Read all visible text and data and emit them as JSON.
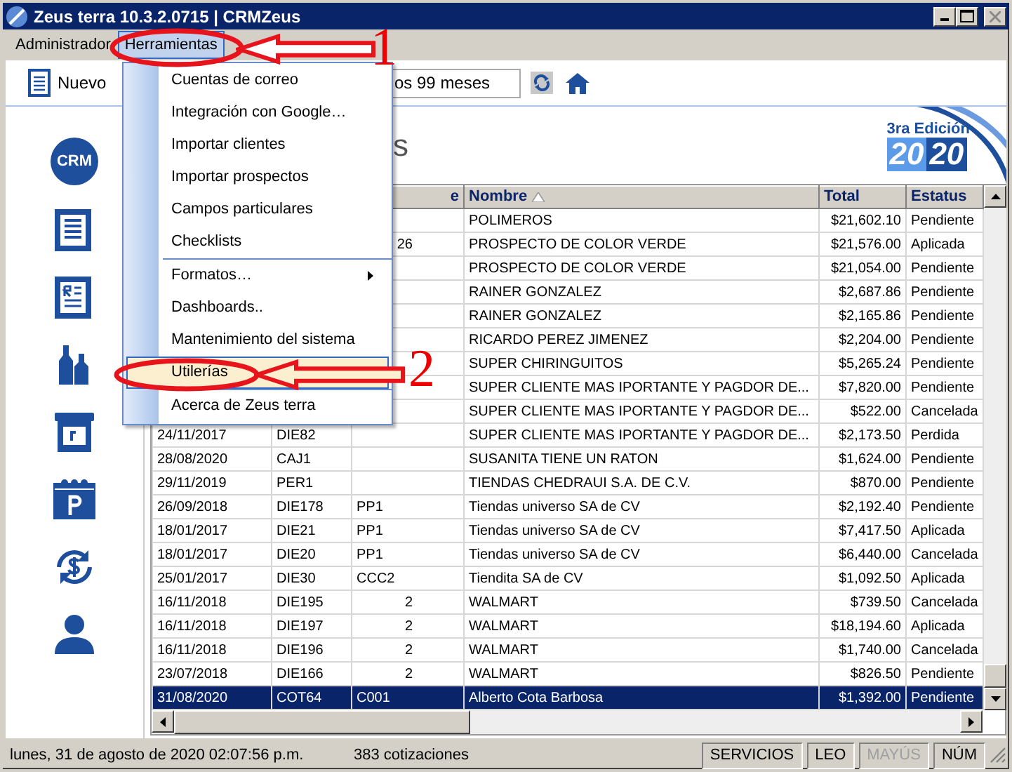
{
  "window": {
    "title": "Zeus terra 10.3.2.0715 | CRMZeus"
  },
  "menu_bar": [
    {
      "label": "Administrador",
      "selected": false
    },
    {
      "label": "Herramientas",
      "selected": true
    }
  ],
  "toolbar": {
    "new_button": "Nuevo",
    "period_field": "os 99 meses"
  },
  "dropdown_menu": [
    {
      "kind": "item",
      "label": "Cuentas de correo",
      "selected": false
    },
    {
      "kind": "item",
      "label": "Integración con Google…",
      "selected": false
    },
    {
      "kind": "item",
      "label": "Importar clientes",
      "selected": false
    },
    {
      "kind": "item",
      "label": "Importar prospectos",
      "selected": false
    },
    {
      "kind": "item",
      "label": "Campos particulares",
      "selected": false
    },
    {
      "kind": "item",
      "label": "Checklists",
      "selected": false
    },
    {
      "kind": "separator"
    },
    {
      "kind": "submenu",
      "label": "Formatos…",
      "selected": false
    },
    {
      "kind": "item",
      "label": "Dashboards..",
      "selected": false
    },
    {
      "kind": "item",
      "label": "Mantenimiento del sistema",
      "selected": false
    },
    {
      "kind": "item",
      "label": "Utilerías",
      "selected": true
    },
    {
      "kind": "separator"
    },
    {
      "kind": "item",
      "label": "Acerca de Zeus terra",
      "selected": false
    }
  ],
  "annotations": [
    {
      "number": "1"
    },
    {
      "number": "2"
    }
  ],
  "sidebar": {
    "logo": "CRM"
  },
  "page_heading": "s",
  "edition_badge": {
    "label": "3ra Edición",
    "year_parts": [
      "20",
      "20"
    ]
  },
  "table": {
    "columns": [
      {
        "label": "e",
        "sorted": false
      },
      {
        "label": "Nombre",
        "sorted": true
      },
      {
        "label": "Total",
        "sorted": false
      },
      {
        "label": "Estatus",
        "sorted": false
      }
    ],
    "rows": [
      {
        "name": "POLIMEROS",
        "total": "$21,602.10",
        "status": "Pendiente",
        "selected": false
      },
      {
        "column_3": "26",
        "name": "PROSPECTO DE COLOR VERDE",
        "total": "$21,576.00",
        "status": "Aplicada",
        "selected": false
      },
      {
        "name": "PROSPECTO DE COLOR VERDE",
        "total": "$21,054.00",
        "status": "Pendiente",
        "selected": false
      },
      {
        "name": "RAINER GONZALEZ",
        "total": "$2,687.86",
        "status": "Pendiente",
        "selected": false
      },
      {
        "name": "RAINER GONZALEZ",
        "total": "$2,165.86",
        "status": "Pendiente",
        "selected": false
      },
      {
        "name": "RICARDO PEREZ JIMENEZ",
        "total": "$2,204.00",
        "status": "Pendiente",
        "selected": false
      },
      {
        "name": "SUPER CHIRINGUITOS",
        "total": "$5,265.24",
        "status": "Pendiente",
        "selected": false
      },
      {
        "name": "SUPER CLIENTE MAS IPORTANTE Y PAGDOR DE...",
        "total": "$7,820.00",
        "status": "Pendiente",
        "selected": false
      },
      {
        "name": "SUPER CLIENTE MAS IPORTANTE Y PAGDOR DE...",
        "total": "$522.00",
        "status": "Cancelada",
        "selected": false
      },
      {
        "date": "24/11/2017",
        "folio": "DIE82",
        "name": "SUPER CLIENTE MAS IPORTANTE Y PAGDOR DE...",
        "total": "$2,173.50",
        "status": "Perdida",
        "selected": false
      },
      {
        "date": "28/08/2020",
        "folio": "CAJ1",
        "name": "SUSANITA TIENE UN RATON",
        "total": "$1,624.00",
        "status": "Pendiente",
        "selected": false
      },
      {
        "date": "29/11/2019",
        "folio": "PER1",
        "name": "TIENDAS CHEDRAUI S.A. DE C.V.",
        "total": "$870.00",
        "status": "Pendiente",
        "selected": false
      },
      {
        "date": "26/09/2018",
        "folio": "DIE178",
        "column_3": "PP1",
        "name": "Tiendas universo SA de CV",
        "total": "$2,192.40",
        "status": "Pendiente",
        "selected": false
      },
      {
        "date": "18/01/2017",
        "folio": "DIE21",
        "column_3": "PP1",
        "name": "Tiendas universo SA de CV",
        "total": "$7,417.50",
        "status": "Aplicada",
        "selected": false
      },
      {
        "date": "18/01/2017",
        "folio": "DIE20",
        "column_3": "PP1",
        "name": "Tiendas universo SA de CV",
        "total": "$6,440.00",
        "status": "Cancelada",
        "selected": false
      },
      {
        "date": "25/01/2017",
        "folio": "DIE30",
        "column_3": "CCC2",
        "name": "Tiendita SA de CV",
        "total": "$1,092.50",
        "status": "Aplicada",
        "selected": false
      },
      {
        "date": "16/11/2018",
        "folio": "DIE195",
        "column_3": "2",
        "name": "WALMART",
        "total": "$739.50",
        "status": "Cancelada",
        "selected": false
      },
      {
        "date": "16/11/2018",
        "folio": "DIE197",
        "column_3": "2",
        "name": "WALMART",
        "total": "$18,194.60",
        "status": "Aplicada",
        "selected": false
      },
      {
        "date": "16/11/2018",
        "folio": "DIE196",
        "column_3": "2",
        "name": "WALMART",
        "total": "$1,740.00",
        "status": "Cancelada",
        "selected": false
      },
      {
        "date": "23/07/2018",
        "folio": "DIE166",
        "column_3": "2",
        "name": "WALMART",
        "total": "$826.50",
        "status": "Pendiente",
        "selected": false
      },
      {
        "date": "31/08/2020",
        "folio": "COT64",
        "column_3": "C001",
        "name": "Alberto Cota Barbosa",
        "total": "$1,392.00",
        "status": "Pendiente",
        "selected": true
      }
    ]
  },
  "status_bar": {
    "datetime": "lunes, 31 de agosto de 2020 02:07:56 p.m.",
    "count": "383 cotizaciones",
    "panels": [
      {
        "label": "SERVICIOS",
        "disabled": false
      },
      {
        "label": "LEO",
        "disabled": false
      },
      {
        "label": "MAYÚS",
        "disabled": true
      },
      {
        "label": "NÚM",
        "disabled": false
      }
    ]
  }
}
